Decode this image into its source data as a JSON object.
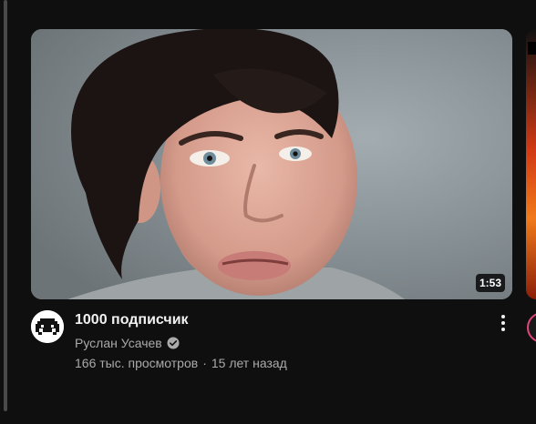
{
  "video": {
    "title": "1000 подписчик",
    "duration": "1:53",
    "channel": "Руслан Усачев",
    "views": "166 тыс. просмотров",
    "separator": "·",
    "published": "15 лет назад"
  },
  "icons": {
    "verified": "verified-check-icon",
    "menu": "more-vert-icon"
  },
  "colors": {
    "background": "#0f0f0f",
    "title": "#f1f1f1",
    "secondary": "#aaaaaa"
  }
}
